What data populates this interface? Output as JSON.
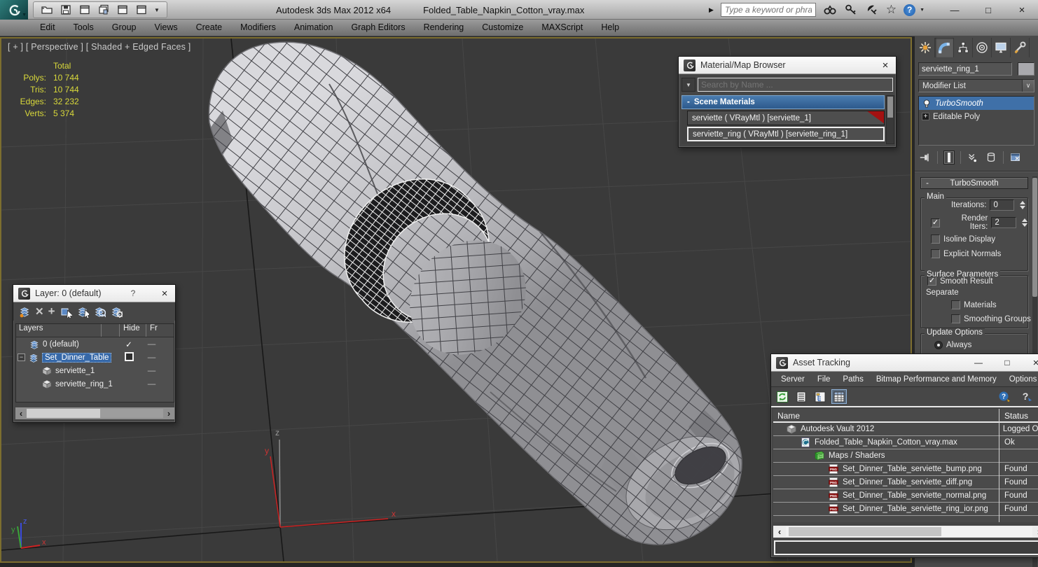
{
  "glyphs": {
    "close": "×",
    "minimize": "—",
    "maximize": "□",
    "help": "?",
    "check": "✓",
    "dash": "—",
    "plus": "+",
    "minus": "−",
    "collapse": "-",
    "star": "☆",
    "flyout": "▶",
    "dropdown": "▼",
    "chevron": "∨",
    "arrow_left": "‹",
    "arrow_right": "›",
    "x_big": "✕"
  },
  "titlebar": {
    "app_title": "Autodesk 3ds Max  2012 x64",
    "file_title": "Folded_Table_Napkin_Cotton_vray.max",
    "search_placeholder": "Type a keyword or phrase"
  },
  "menubar": {
    "items": [
      "Edit",
      "Tools",
      "Group",
      "Views",
      "Create",
      "Modifiers",
      "Animation",
      "Graph Editors",
      "Rendering",
      "Customize",
      "MAXScript",
      "Help"
    ]
  },
  "viewport": {
    "label": "[ + ] [ Perspective ] [ Shaded + Edged Faces ]",
    "stats_header": "Total",
    "stats": [
      {
        "label": "Polys:",
        "value": "10 744"
      },
      {
        "label": "Tris:",
        "value": "10 744"
      },
      {
        "label": "Edges:",
        "value": "32 232"
      },
      {
        "label": "Verts:",
        "value": "5 374"
      }
    ],
    "axes": {
      "x": "x",
      "y": "y",
      "z": "z"
    }
  },
  "material_browser": {
    "title": "Material/Map Browser",
    "search_placeholder": "Search by Name ...",
    "group_label": "Scene Materials",
    "items": [
      "serviette ( VRayMtl ) [serviette_1]",
      "serviette_ring ( VRayMtl ) [serviette_ring_1]"
    ]
  },
  "layer_dialog": {
    "title": "Layer: 0 (default)",
    "col_layers": "Layers",
    "col_hide": "Hide",
    "col_freeze": "Fr",
    "rows": [
      {
        "label": "0 (default)"
      },
      {
        "label": "Set_Dinner_Table"
      },
      {
        "label": "serviette_1"
      },
      {
        "label": "serviette_ring_1"
      }
    ]
  },
  "asset_tracking": {
    "title": "Asset Tracking",
    "menus": [
      "Server",
      "File",
      "Paths",
      "Bitmap Performance and Memory",
      "Options"
    ],
    "col_name": "Name",
    "col_status": "Status",
    "rows": [
      {
        "name": "Autodesk Vault 2012",
        "status": "Logged Out"
      },
      {
        "name": "Folded_Table_Napkin_Cotton_vray.max",
        "status": "Ok"
      },
      {
        "name": "Maps / Shaders",
        "status": ""
      },
      {
        "name": "Set_Dinner_Table_serviette_bump.png",
        "status": "Found"
      },
      {
        "name": "Set_Dinner_Table_serviette_diff.png",
        "status": "Found"
      },
      {
        "name": "Set_Dinner_Table_serviette_normal.png",
        "status": "Found"
      },
      {
        "name": "Set_Dinner_Table_serviette_ring_ior.png",
        "status": "Found"
      }
    ]
  },
  "command_panel": {
    "object_name": "serviette_ring_1",
    "modifier_list": "Modifier List",
    "stack": [
      {
        "label": "TurboSmooth"
      },
      {
        "label": "Editable Poly"
      }
    ],
    "rollout_title": "TurboSmooth",
    "main_legend": "Main",
    "iterations_label": "Iterations:",
    "iterations_value": "0",
    "render_iters_label": "Render Iters:",
    "render_iters_value": "2",
    "isoline_label": "Isoline Display",
    "explicit_label": "Explicit Normals",
    "surface_legend": "Surface Parameters",
    "smooth_label": "Smooth Result",
    "separate_label": "Separate",
    "materials_label": "Materials",
    "smoothing_label": "Smoothing Groups",
    "update_legend": "Update Options",
    "always_label": "Always"
  },
  "colors": {
    "selection_blue": "#3f70a8",
    "stats_yellow": "#d9d93a",
    "viewport_border": "#7d6e2f",
    "material_red_corner": "#a31111",
    "panel_gray": "#4a4a4a"
  }
}
